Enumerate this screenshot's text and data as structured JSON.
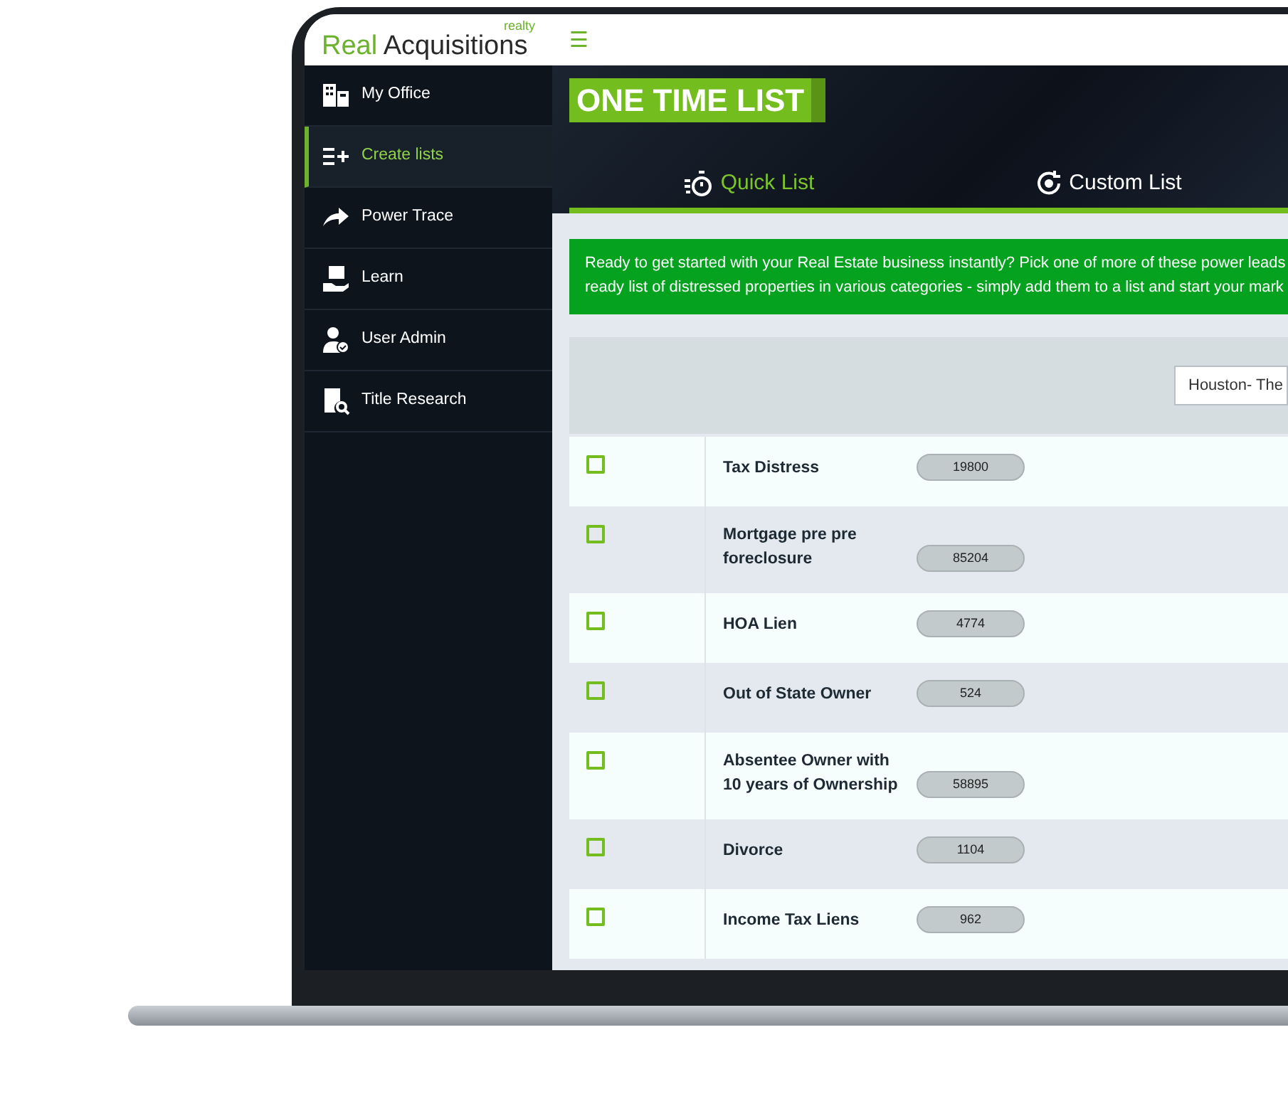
{
  "header": {
    "logo": {
      "part_1": "Real",
      "part_2": "Acquisitions",
      "tag": "realty"
    },
    "menu_glyph": "☰"
  },
  "sidebar": {
    "items": [
      {
        "label": "My Office",
        "selected": false
      },
      {
        "label": "Create lists",
        "selected": true
      },
      {
        "label": "Power Trace",
        "selected": false
      },
      {
        "label": "Learn",
        "selected": false
      },
      {
        "label": "User Admin",
        "selected": false
      },
      {
        "label": "Title Research",
        "selected": false
      }
    ]
  },
  "page_title": "ONE TIME LIST",
  "tabs": [
    {
      "label": "Quick List",
      "selected": true
    },
    {
      "label": "Custom List",
      "selected": false
    }
  ],
  "banner": "Ready to get started with your Real Estate business instantly? Pick one of more of these power leads\nready list of distressed properties in various categories - simply add them to a list and start your mark",
  "filter": {
    "value": "Houston- The"
  },
  "rows": [
    {
      "label": "Tax Distress",
      "count": "19800",
      "checked": false
    },
    {
      "label": "Mortgage pre pre foreclosure",
      "count": "85204",
      "checked": false
    },
    {
      "label": "HOA Lien",
      "count": "4774",
      "checked": false
    },
    {
      "label": "Out of State Owner",
      "count": "524",
      "checked": false
    },
    {
      "label": "Absentee Owner with 10 years of Ownership",
      "count": "58895",
      "checked": false
    },
    {
      "label": "Divorce",
      "count": "1104",
      "checked": false
    },
    {
      "label": "Income Tax Liens",
      "count": "962",
      "checked": false
    }
  ]
}
